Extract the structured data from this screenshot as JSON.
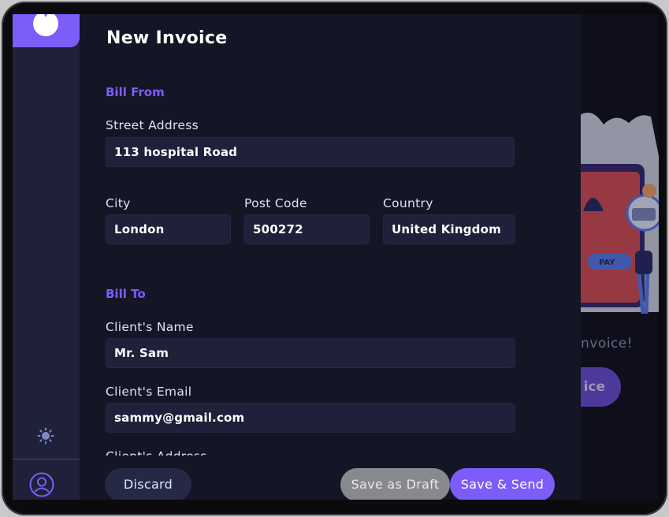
{
  "colors": {
    "accent": "#7c5dfa",
    "panel_bg": "#141625",
    "field_bg": "#1e2139",
    "draft_button": "#88898e"
  },
  "sidebar": {
    "logo_icon": "logo-icon",
    "theme_icon": "sun-icon",
    "avatar_icon": "user-avatar-icon"
  },
  "background": {
    "empty_text": "nvoice!",
    "button_label": "ice"
  },
  "form": {
    "title": "New Invoice",
    "bill_from": {
      "heading": "Bill From",
      "street_label": "Street Address",
      "street_value": "113 hospital Road",
      "city_label": "City",
      "city_value": "London",
      "postcode_label": "Post Code",
      "postcode_value": "500272",
      "country_label": "Country",
      "country_value": "United Kingdom"
    },
    "bill_to": {
      "heading": "Bill To",
      "client_name_label": "Client's Name",
      "client_name_value": "Mr. Sam",
      "client_email_label": "Client's Email",
      "client_email_value": "sammy@gmail.com",
      "client_address_label": "Client's Address"
    }
  },
  "footer": {
    "discard_label": "Discard",
    "draft_label": "Save as Draft",
    "send_label": "Save & Send"
  }
}
